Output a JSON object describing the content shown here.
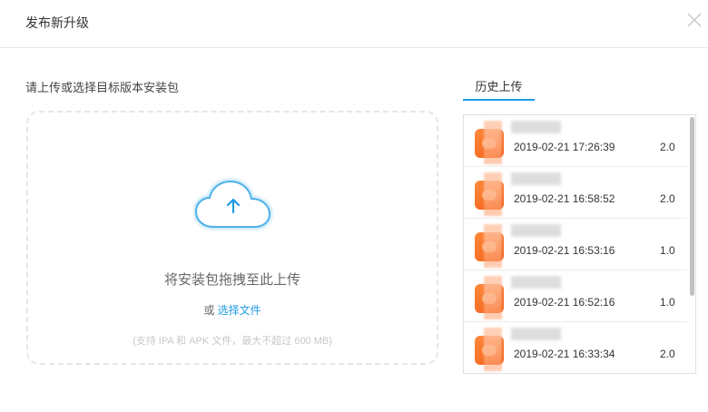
{
  "dialog": {
    "title": "发布新升级"
  },
  "upload": {
    "prompt": "请上传或选择目标版本安装包",
    "drop_text": "将安装包拖拽至此上传",
    "or_text": "或",
    "choose_file": "选择文件",
    "hint": "(支持 IPA 和 APK 文件，最大不超过 600 MB)"
  },
  "history": {
    "tab_label": "历史上传",
    "items": [
      {
        "date": "2019-02-21 17:26:39",
        "version": "2.0"
      },
      {
        "date": "2019-02-21 16:58:52",
        "version": "2.0"
      },
      {
        "date": "2019-02-21 16:53:16",
        "version": "1.0"
      },
      {
        "date": "2019-02-21 16:52:16",
        "version": "1.0"
      },
      {
        "date": "2019-02-21 16:33:34",
        "version": "2.0"
      }
    ]
  },
  "colors": {
    "accent": "#1e9be5",
    "icon_orange": "#f25a12"
  },
  "icons": {
    "close": "close-icon",
    "cloud": "cloud-upload-icon",
    "app": "app-icon"
  }
}
